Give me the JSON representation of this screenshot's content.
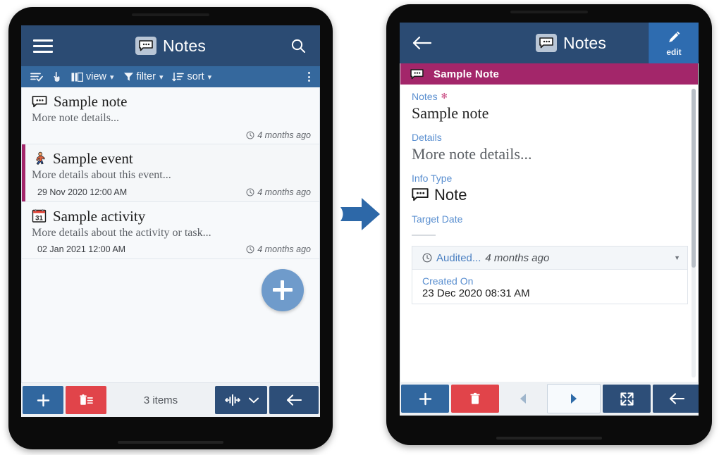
{
  "list_screen": {
    "header": {
      "menu_icon": "hamburger-icon",
      "badge_icon": "note-bubble-icon",
      "title": "Notes",
      "search_icon": "search-icon"
    },
    "toolbar": {
      "select_icon": "select-rows-icon",
      "touch_icon": "touch-pointer-icon",
      "view_label": "view",
      "filter_label": "filter",
      "sort_label": "sort",
      "overflow_icon": "kebab-menu-icon"
    },
    "rows": [
      {
        "icon": "note-bubble-icon",
        "title": "Sample note",
        "subtitle": "More note details...",
        "date": "",
        "ago": "4 months ago",
        "accent": false
      },
      {
        "icon": "running-person-icon",
        "title": "Sample event",
        "subtitle": "More details about this event...",
        "date": "29 Nov 2020 12:00 AM",
        "ago": "4 months ago",
        "accent": true
      },
      {
        "icon": "calendar-31-icon",
        "title": "Sample activity",
        "subtitle": "More details about the activity or task...",
        "date": "02 Jan 2021 12:00 AM",
        "ago": "4 months ago",
        "accent": false
      }
    ],
    "fab": {
      "icon": "plus-icon"
    },
    "bottom_bar": {
      "add_icon": "plus-icon",
      "delete_icon": "trash-list-icon",
      "count_label": "3 items",
      "split_icon": "split-view-icon",
      "split_caret": "chevron-down-icon",
      "back_icon": "arrow-left-icon"
    }
  },
  "detail_screen": {
    "header": {
      "back_icon": "arrow-left-icon",
      "badge_icon": "note-bubble-icon",
      "title": "Notes",
      "edit_icon": "pencil-icon",
      "edit_label": "edit"
    },
    "record_bar": {
      "icon": "note-bubble-icon",
      "title": "Sample Note"
    },
    "fields": [
      {
        "label": "Notes",
        "required": true,
        "value": "Sample note",
        "style": "serif"
      },
      {
        "label": "Details",
        "required": false,
        "value": "More note details...",
        "style": "serif-muted"
      },
      {
        "label": "Info Type",
        "required": false,
        "value": "Note",
        "style": "icon",
        "icon": "note-bubble-icon"
      },
      {
        "label": "Target Date",
        "required": false,
        "value": "",
        "style": "empty"
      }
    ],
    "audit": {
      "clock_icon": "clock-icon",
      "head_text": "Audited...",
      "head_ago": "4 months ago",
      "caret_icon": "chevron-down-icon",
      "rows": [
        {
          "label": "Created On",
          "value": "23 Dec 2020 08:31 AM"
        }
      ]
    },
    "bottom_bar": {
      "add_icon": "plus-icon",
      "delete_icon": "trash-icon",
      "prev_icon": "triangle-left-icon",
      "next_icon": "triangle-right-icon",
      "expand_icon": "expand-arrows-icon",
      "back_icon": "arrow-left-icon"
    }
  },
  "flow": {
    "arrow_icon": "arrow-right-icon"
  },
  "colors": {
    "header_navy": "#2b4b73",
    "toolbar_blue": "#35689d",
    "accent_magenta": "#a3266a",
    "edit_blue": "#2e6cb0",
    "button_blue": "#31679f",
    "button_red": "#e1444a",
    "button_navy": "#2d4e78",
    "fab_blue": "#6f9bcb",
    "label_blue": "#5a8fd0",
    "flow_arrow_blue": "#2d68a8"
  }
}
